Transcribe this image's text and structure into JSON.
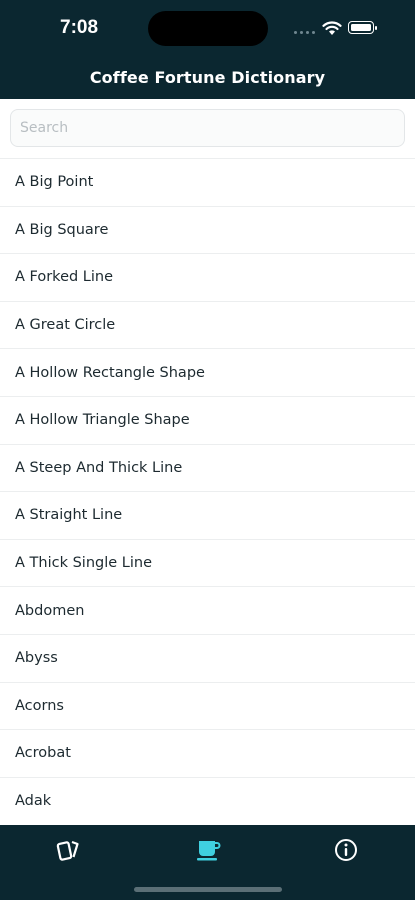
{
  "status": {
    "time": "7:08"
  },
  "header": {
    "title": "Coffee Fortune Dictionary"
  },
  "search": {
    "placeholder": "Search",
    "value": ""
  },
  "list": {
    "items": [
      "A Big Point",
      "A Big Square",
      "A Forked Line",
      "A Great Circle",
      "A Hollow Rectangle Shape",
      "A Hollow Triangle Shape",
      "A Steep And Thick Line",
      "A Straight Line",
      "A Thick Single Line",
      "Abdomen",
      "Abyss",
      "Acorns",
      "Acrobat",
      "Adak"
    ]
  },
  "tabbar": {
    "tabs": [
      {
        "icon": "cards-icon",
        "active": false
      },
      {
        "icon": "coffee-cup-icon",
        "active": true
      },
      {
        "icon": "info-icon",
        "active": false
      }
    ],
    "active_color": "#3fd0e0",
    "inactive_color": "#ffffff"
  },
  "colors": {
    "header_bg": "#0b2730",
    "text": "#1d2a30"
  }
}
